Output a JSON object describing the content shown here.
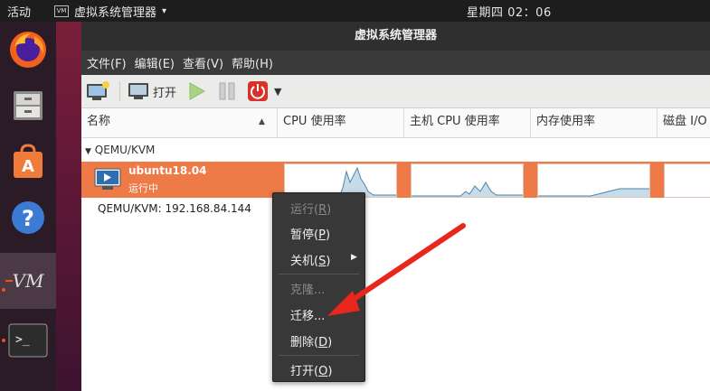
{
  "topbar": {
    "activities": "活动",
    "app_menu": "虚拟系统管理器",
    "clock": "星期四 02：06"
  },
  "window": {
    "title": "虚拟系统管理器",
    "menu": [
      "文件(F)",
      "编辑(E)",
      "查看(V)",
      "帮助(H)"
    ]
  },
  "toolbar": {
    "open_label": "打开"
  },
  "columns": {
    "name": "名称",
    "cpu": "CPU 使用率",
    "host_cpu": "主机 CPU 使用率",
    "memory": "内存使用率",
    "disk": "磁盘 I/O"
  },
  "list": {
    "group": "QEMU/KVM",
    "vm": {
      "name": "ubuntu18.04",
      "status": "运行中"
    },
    "connection": "QEMU/KVM: 192.168.84.144"
  },
  "context_menu": {
    "run": {
      "label": "运行",
      "key": "R"
    },
    "pause": {
      "label": "暂停",
      "key": "P"
    },
    "shutdown": {
      "label": "关机",
      "key": "S"
    },
    "clone": "克隆...",
    "migrate": "迁移...",
    "delete": {
      "label": "删除",
      "key": "D"
    },
    "open": {
      "label": "打开",
      "key": "O"
    }
  },
  "colors": {
    "selection": "#ee7a47",
    "accent": "#e95420",
    "graph_line": "#4a86a8",
    "annotation_arrow": "#e8261c"
  }
}
